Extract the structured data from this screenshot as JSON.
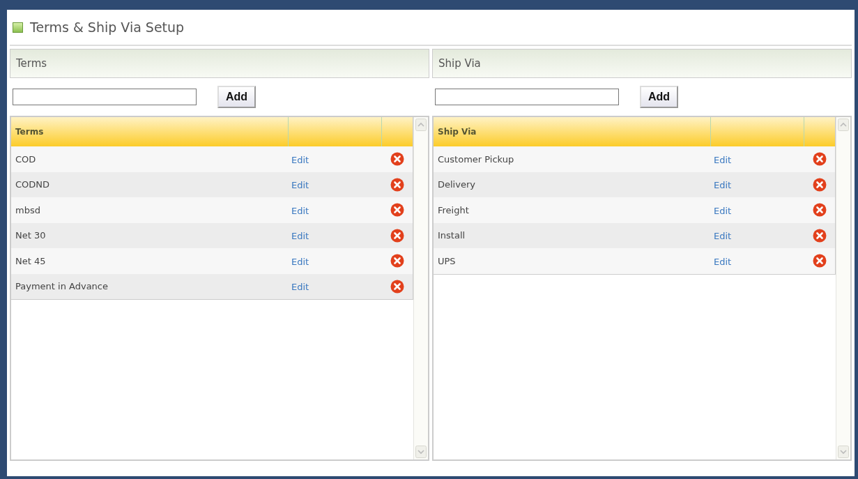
{
  "window": {
    "title": "Terms & Ship Via Setup"
  },
  "panels": [
    {
      "header": "Terms",
      "add_button": "Add",
      "table": {
        "column_1": "Terms",
        "rows": [
          {
            "name": "COD",
            "action": "Edit"
          },
          {
            "name": "CODND",
            "action": "Edit"
          },
          {
            "name": "mbsd",
            "action": "Edit"
          },
          {
            "name": "Net 30",
            "action": "Edit"
          },
          {
            "name": "Net 45",
            "action": "Edit"
          },
          {
            "name": "Payment in Advance",
            "action": "Edit"
          }
        ]
      }
    },
    {
      "header": "Ship Via",
      "add_button": "Add",
      "table": {
        "column_1": "Ship Via",
        "rows": [
          {
            "name": "Customer Pickup",
            "action": "Edit"
          },
          {
            "name": "Delivery",
            "action": "Edit"
          },
          {
            "name": "Freight",
            "action": "Edit"
          },
          {
            "name": "Install",
            "action": "Edit"
          },
          {
            "name": "UPS",
            "action": "Edit"
          }
        ]
      }
    }
  ]
}
